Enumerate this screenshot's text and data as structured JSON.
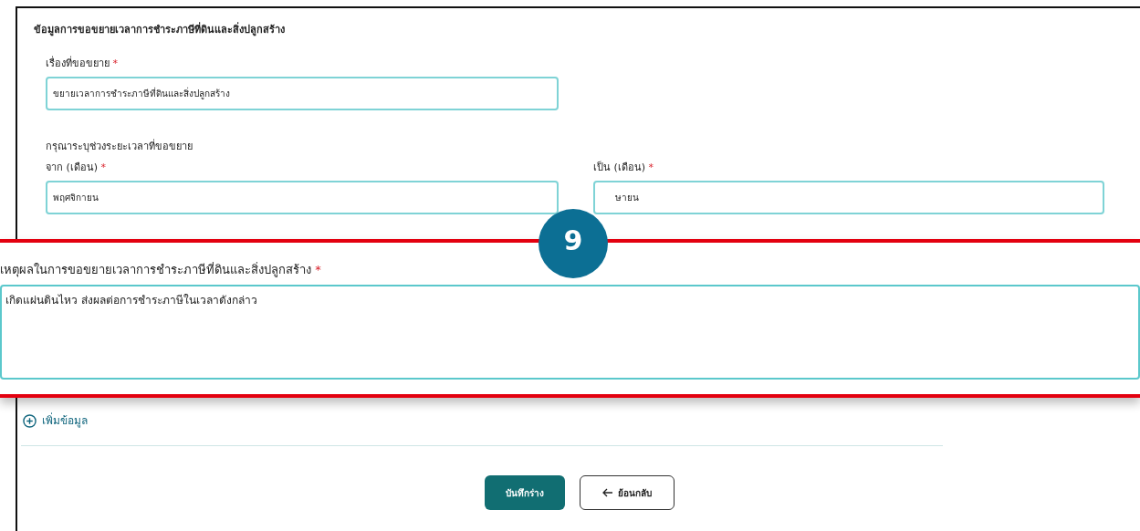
{
  "section_title": "ข้อมูลการขอขยายเวลาการชำระภาษีที่ดินและสิ่งปลูกสร้าง",
  "subject": {
    "label": "เรื่องที่ขอขยาย",
    "required_mark": "*",
    "value": "ขยายเวลาการชำระภาษีที่ดินและสิ่งปลูกสร้าง"
  },
  "period_hint": "กรุณาระบุช่วงระยะเวลาที่ขอขยาย",
  "period_fields": [
    {
      "label": "จาก (เดือน)",
      "required_mark": "*",
      "value": "พฤศจิกายน"
    },
    {
      "label": "เป็น (เดือน)",
      "required_mark": "*",
      "value": "ษายน"
    }
  ],
  "callout": {
    "number": "9",
    "reason": {
      "label": "เหตุผลในการขอขยายเวลาการชำระภาษีที่ดินและสิ่งปลูกสร้าง",
      "required_mark": "*",
      "value": "เกิดแผ่นดินไหว ส่งผลต่อการชำระภาษีในเวลาดังกล่าว"
    }
  },
  "add_link": "เพิ่มข้อมูล",
  "buttons": [
    {
      "kind": "primary",
      "label": "บันทึกร่าง"
    },
    {
      "kind": "back",
      "label": "ย้อนกลับ"
    }
  ]
}
